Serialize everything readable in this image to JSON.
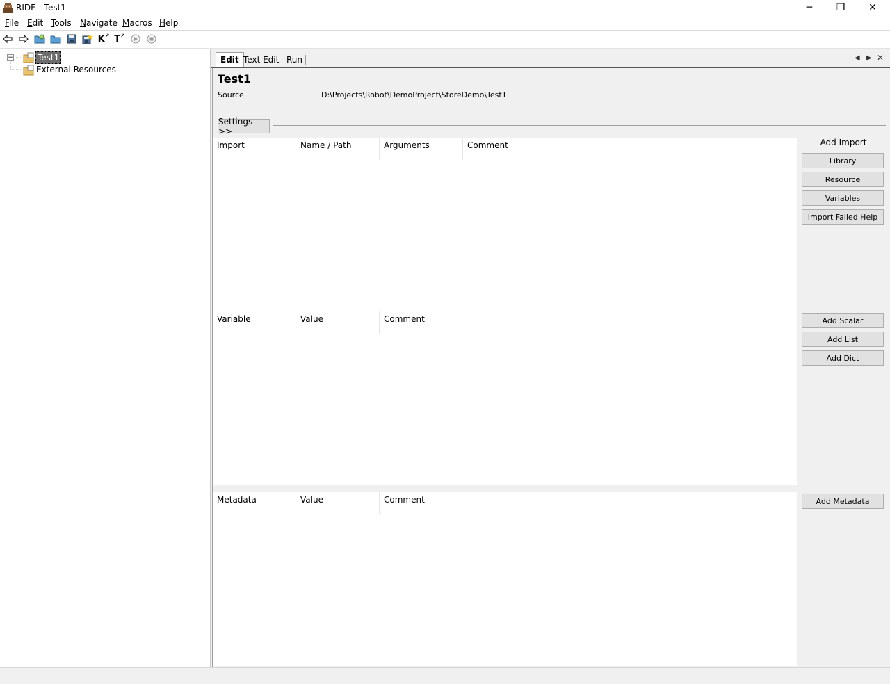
{
  "window": {
    "title": "RIDE - Test1",
    "controls": {
      "minimize": "─",
      "restore": "❐",
      "close": "✕"
    }
  },
  "menu": {
    "items": [
      {
        "label": "File",
        "mnemonic": "F"
      },
      {
        "label": "Edit",
        "mnemonic": "E"
      },
      {
        "label": "Tools",
        "mnemonic": "T"
      },
      {
        "label": "Navigate",
        "mnemonic": "N"
      },
      {
        "label": "Macros",
        "mnemonic": "M"
      },
      {
        "label": "Help",
        "mnemonic": "H"
      }
    ]
  },
  "toolbar": {
    "buttons": [
      "back-icon",
      "forward-icon",
      "open-test-suite-icon",
      "open-directory-icon",
      "save-icon",
      "save-all-icon",
      "search-keywords-icon",
      "search-tests-icon",
      "run-icon",
      "stop-icon"
    ],
    "keyword_search_glyph": "K",
    "test_search_glyph": "T"
  },
  "tree": {
    "root": {
      "label": "Test1",
      "expander": "⊟"
    },
    "child": {
      "label": "External Resources"
    }
  },
  "tabs": {
    "items": [
      "Edit",
      "Text Edit",
      "Run"
    ],
    "active": "Edit",
    "nav": {
      "left": "◀",
      "right": "▶",
      "close": "✕"
    }
  },
  "editor": {
    "title": "Test1",
    "source_label": "Source",
    "source_value": "D:\\Projects\\Robot\\DemoProject\\StoreDemo\\Test1",
    "settings_button": "Settings >>"
  },
  "imports": {
    "columns": [
      "Import",
      "Name / Path",
      "Arguments",
      "Comment"
    ],
    "side_label": "Add Import",
    "buttons": [
      "Library",
      "Resource",
      "Variables",
      "Import Failed Help"
    ]
  },
  "variables": {
    "columns": [
      "Variable",
      "Value",
      "Comment"
    ],
    "buttons": [
      "Add Scalar",
      "Add List",
      "Add Dict"
    ]
  },
  "metadata": {
    "columns": [
      "Metadata",
      "Value",
      "Comment"
    ],
    "buttons": [
      "Add Metadata"
    ]
  }
}
